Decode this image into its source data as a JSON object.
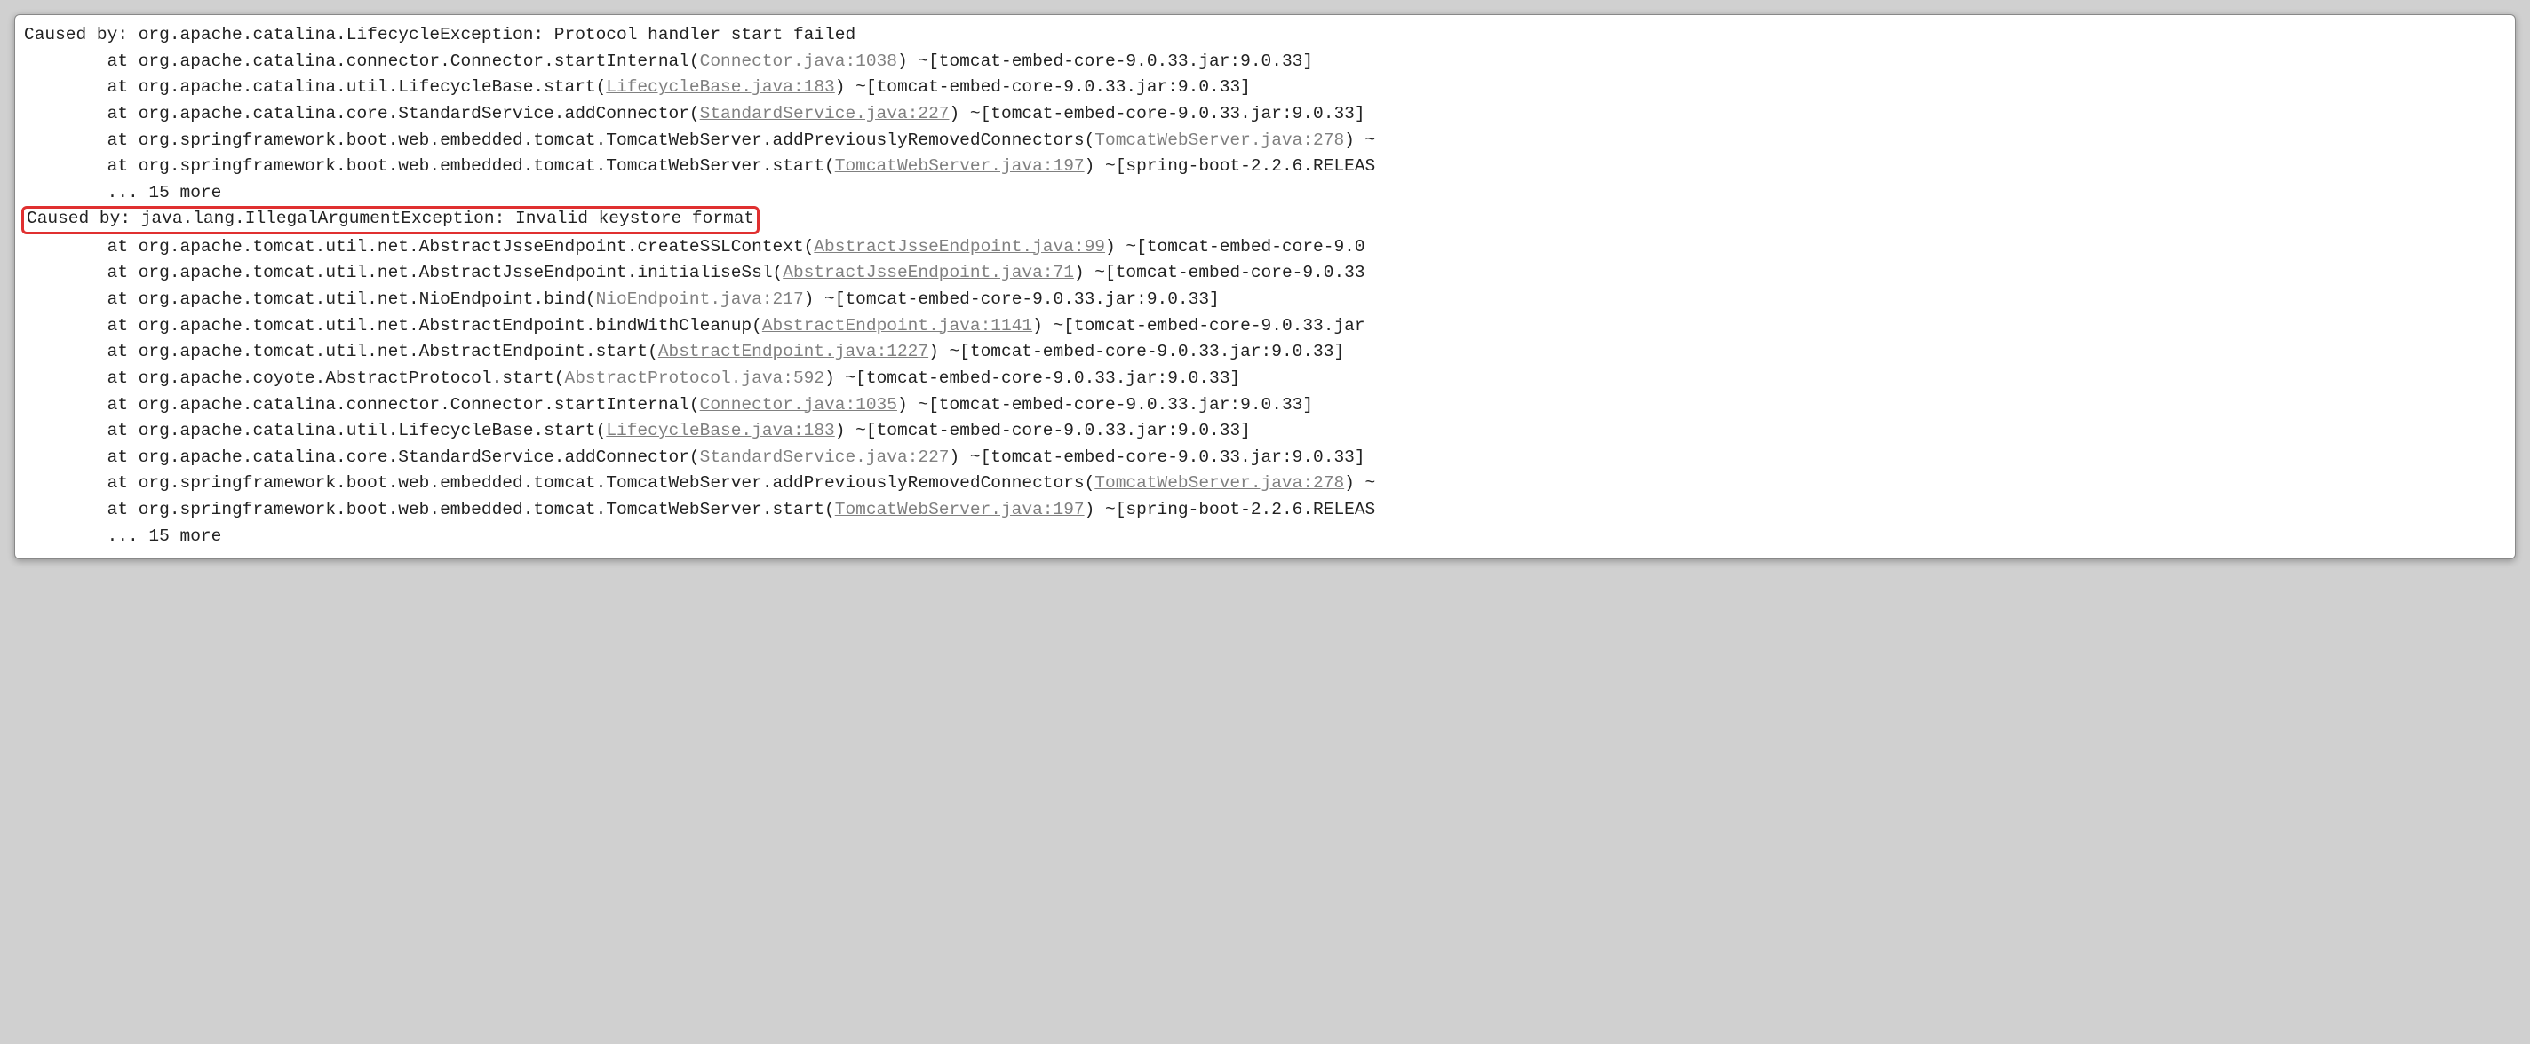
{
  "lines": [
    {
      "type": "caused",
      "prefix": "Caused by: org.apache.catalina.LifecycleException: Protocol handler start failed",
      "link": "",
      "suffix": ""
    },
    {
      "type": "at",
      "prefix": "        at org.apache.catalina.connector.Connector.startInternal(",
      "link": "Connector.java:1038",
      "suffix": ") ~[tomcat-embed-core-9.0.33.jar:9.0.33]"
    },
    {
      "type": "at",
      "prefix": "        at org.apache.catalina.util.LifecycleBase.start(",
      "link": "LifecycleBase.java:183",
      "suffix": ") ~[tomcat-embed-core-9.0.33.jar:9.0.33]"
    },
    {
      "type": "at",
      "prefix": "        at org.apache.catalina.core.StandardService.addConnector(",
      "link": "StandardService.java:227",
      "suffix": ") ~[tomcat-embed-core-9.0.33.jar:9.0.33]"
    },
    {
      "type": "at",
      "prefix": "        at org.springframework.boot.web.embedded.tomcat.TomcatWebServer.addPreviouslyRemovedConnectors(",
      "link": "TomcatWebServer.java:278",
      "suffix": ") ~"
    },
    {
      "type": "at",
      "prefix": "        at org.springframework.boot.web.embedded.tomcat.TomcatWebServer.start(",
      "link": "TomcatWebServer.java:197",
      "suffix": ") ~[spring-boot-2.2.6.RELEAS"
    },
    {
      "type": "more",
      "prefix": "        ... 15 more",
      "link": "",
      "suffix": ""
    },
    {
      "type": "highlighted",
      "prefix": "Caused by: java.lang.IllegalArgumentException: Invalid keystore format",
      "link": "",
      "suffix": ""
    },
    {
      "type": "at",
      "prefix": "        at org.apache.tomcat.util.net.AbstractJsseEndpoint.createSSLContext(",
      "link": "AbstractJsseEndpoint.java:99",
      "suffix": ") ~[tomcat-embed-core-9.0"
    },
    {
      "type": "at",
      "prefix": "        at org.apache.tomcat.util.net.AbstractJsseEndpoint.initialiseSsl(",
      "link": "AbstractJsseEndpoint.java:71",
      "suffix": ") ~[tomcat-embed-core-9.0.33"
    },
    {
      "type": "at",
      "prefix": "        at org.apache.tomcat.util.net.NioEndpoint.bind(",
      "link": "NioEndpoint.java:217",
      "suffix": ") ~[tomcat-embed-core-9.0.33.jar:9.0.33]"
    },
    {
      "type": "at",
      "prefix": "        at org.apache.tomcat.util.net.AbstractEndpoint.bindWithCleanup(",
      "link": "AbstractEndpoint.java:1141",
      "suffix": ") ~[tomcat-embed-core-9.0.33.jar"
    },
    {
      "type": "at",
      "prefix": "        at org.apache.tomcat.util.net.AbstractEndpoint.start(",
      "link": "AbstractEndpoint.java:1227",
      "suffix": ") ~[tomcat-embed-core-9.0.33.jar:9.0.33]"
    },
    {
      "type": "at",
      "prefix": "        at org.apache.coyote.AbstractProtocol.start(",
      "link": "AbstractProtocol.java:592",
      "suffix": ") ~[tomcat-embed-core-9.0.33.jar:9.0.33]"
    },
    {
      "type": "at",
      "prefix": "        at org.apache.catalina.connector.Connector.startInternal(",
      "link": "Connector.java:1035",
      "suffix": ") ~[tomcat-embed-core-9.0.33.jar:9.0.33]"
    },
    {
      "type": "at",
      "prefix": "        at org.apache.catalina.util.LifecycleBase.start(",
      "link": "LifecycleBase.java:183",
      "suffix": ") ~[tomcat-embed-core-9.0.33.jar:9.0.33]"
    },
    {
      "type": "at",
      "prefix": "        at org.apache.catalina.core.StandardService.addConnector(",
      "link": "StandardService.java:227",
      "suffix": ") ~[tomcat-embed-core-9.0.33.jar:9.0.33]"
    },
    {
      "type": "at",
      "prefix": "        at org.springframework.boot.web.embedded.tomcat.TomcatWebServer.addPreviouslyRemovedConnectors(",
      "link": "TomcatWebServer.java:278",
      "suffix": ") ~"
    },
    {
      "type": "at",
      "prefix": "        at org.springframework.boot.web.embedded.tomcat.TomcatWebServer.start(",
      "link": "TomcatWebServer.java:197",
      "suffix": ") ~[spring-boot-2.2.6.RELEAS"
    },
    {
      "type": "more",
      "prefix": "        ... 15 more",
      "link": "",
      "suffix": ""
    }
  ]
}
